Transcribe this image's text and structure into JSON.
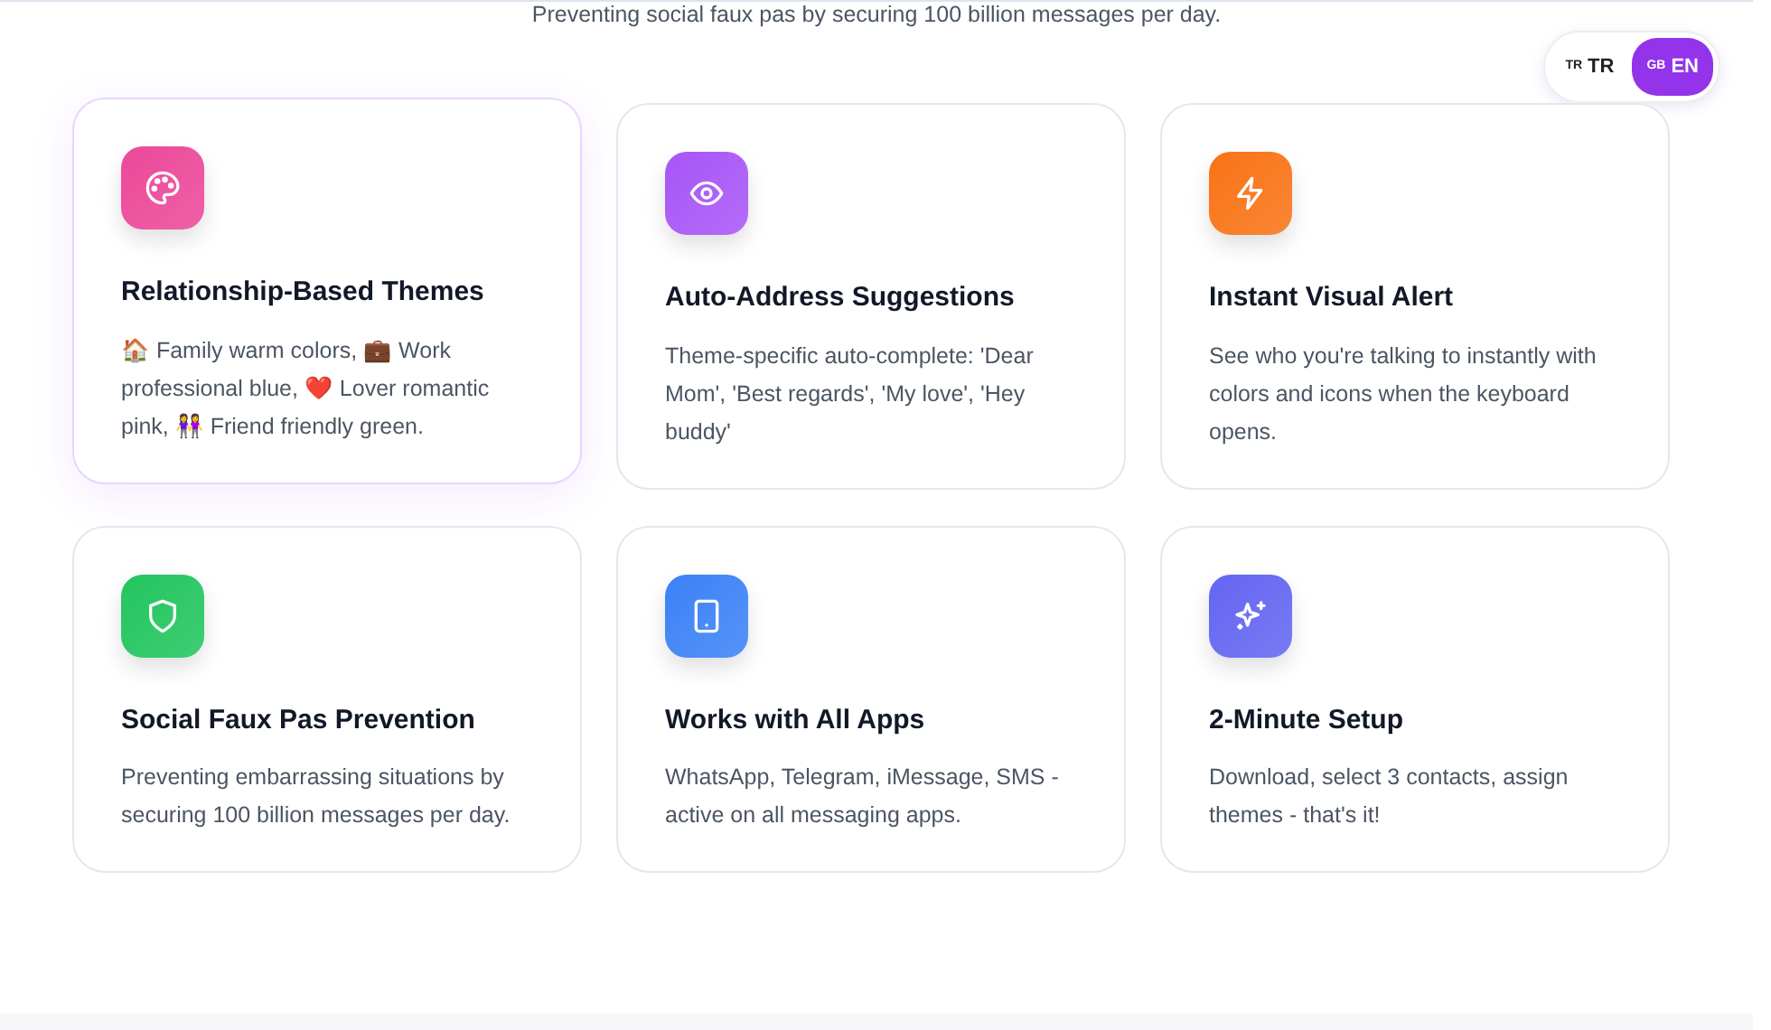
{
  "intro": "Preventing social faux pas by securing 100 billion messages per day.",
  "language_switch": [
    {
      "flag": "TR",
      "label": "TR",
      "selected": false
    },
    {
      "flag": "GB",
      "label": "EN",
      "selected": true
    }
  ],
  "features": [
    {
      "kind": "palette",
      "color": "#ec4899",
      "title": "Relationship-Based Themes",
      "description": "🏠 Family warm colors, 💼 Work professional blue, ❤️ Lover romantic pink, 👭 Friend friendly green.",
      "highlighted": true
    },
    {
      "kind": "eye",
      "color": "#a855f7",
      "title": "Auto-Address Suggestions",
      "description": "Theme-specific auto-complete: 'Dear Mom', 'Best regards', 'My love', 'Hey buddy'",
      "highlighted": false
    },
    {
      "kind": "bolt",
      "color": "#f97316",
      "title": "Instant Visual Alert",
      "description": "See who you're talking to instantly with colors and icons when the keyboard opens.",
      "highlighted": false
    },
    {
      "kind": "shield",
      "color": "#22c55e",
      "title": "Social Faux Pas Prevention",
      "description": "Preventing embarrassing situations by securing 100 billion messages per day.",
      "highlighted": false
    },
    {
      "kind": "phone",
      "color": "#3b82f6",
      "title": "Works with All Apps",
      "description": "WhatsApp, Telegram, iMessage, SMS - active on all messaging apps.",
      "highlighted": false
    },
    {
      "kind": "sparkles",
      "color": "#6366f1",
      "title": "2-Minute Setup",
      "description": "Download, select 3 contacts, assign themes - that's it!",
      "highlighted": false
    }
  ]
}
